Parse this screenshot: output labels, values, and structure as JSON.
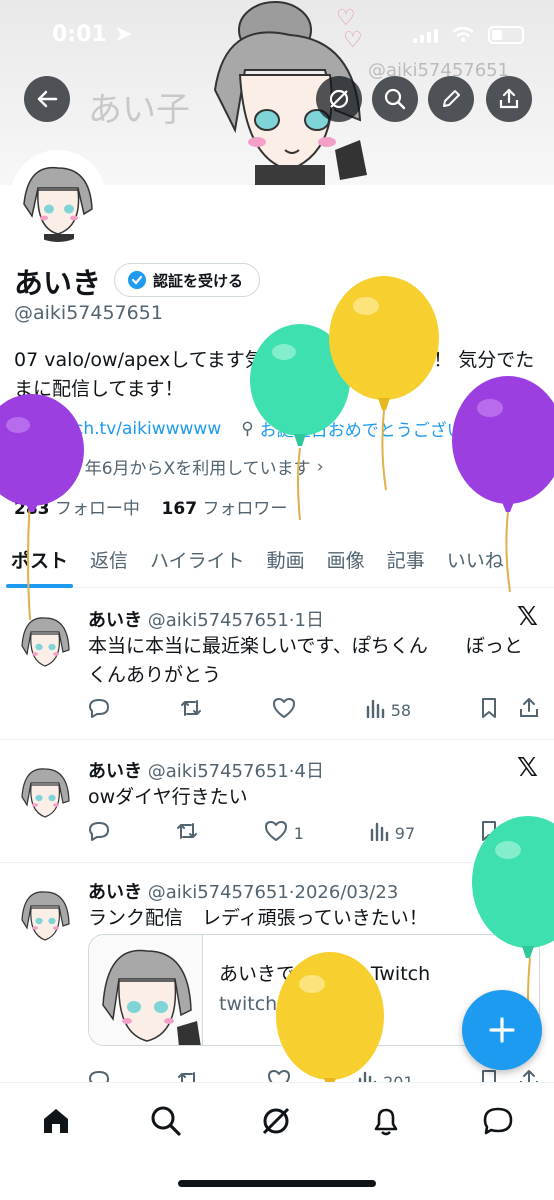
{
  "status_bar": {
    "time": "0:01"
  },
  "banner": {
    "sign": "あい子",
    "watermark": "@aiki57457651"
  },
  "profile": {
    "name": "あいき",
    "verify_label": "認証を受ける",
    "handle": "@aiki57457651",
    "bio": "07 valo/ow/apexしてます気軽に誘ってください！ 気分でたまに配信してます！",
    "link": "Twitch.tv/aikiwwwww",
    "birthday": "お誕生日おめでとうございます。",
    "joined": "2020 年6月からXを利用しています",
    "following_count": "283",
    "following_label": "フォロー中",
    "followers_count": "167",
    "followers_label": "フォロワー"
  },
  "tabs": [
    "ポスト",
    "返信",
    "ハイライト",
    "動画",
    "画像",
    "記事",
    "いいね"
  ],
  "posts": [
    {
      "name": "あいき",
      "meta": "@aiki57457651·1日",
      "text": "本当に本当に最近楽しいです、ぽちくん　　ぼっとくんありがとう",
      "likes": "",
      "views": "58"
    },
    {
      "name": "あいき",
      "meta": "@aiki57457651·4日",
      "text": "owダイヤ行きたい",
      "likes": "1",
      "views": "97"
    },
    {
      "name": "あいき",
      "meta": "@aiki57457651·2026/03/23",
      "text": "ランク配信　レディ頑張っていきたい！",
      "card_title": "あいきですます - Twitch",
      "card_domain": "twitch.tv",
      "views": "201"
    }
  ],
  "icons": {
    "back": "arrow-left-icon",
    "grok": "grok-icon",
    "search": "search-icon",
    "edit": "pencil-icon",
    "share": "share-icon",
    "home": "home-icon",
    "explore": "search-icon",
    "notifications": "bell-icon",
    "messages": "message-icon",
    "compose": "plus-icon"
  },
  "colors": {
    "accent": "#1d9bf0",
    "verified": "#1d9bf0",
    "balloon_purple": "#9b3fe0",
    "balloon_green": "#3ee0b0",
    "balloon_yellow": "#f7cf2f"
  }
}
